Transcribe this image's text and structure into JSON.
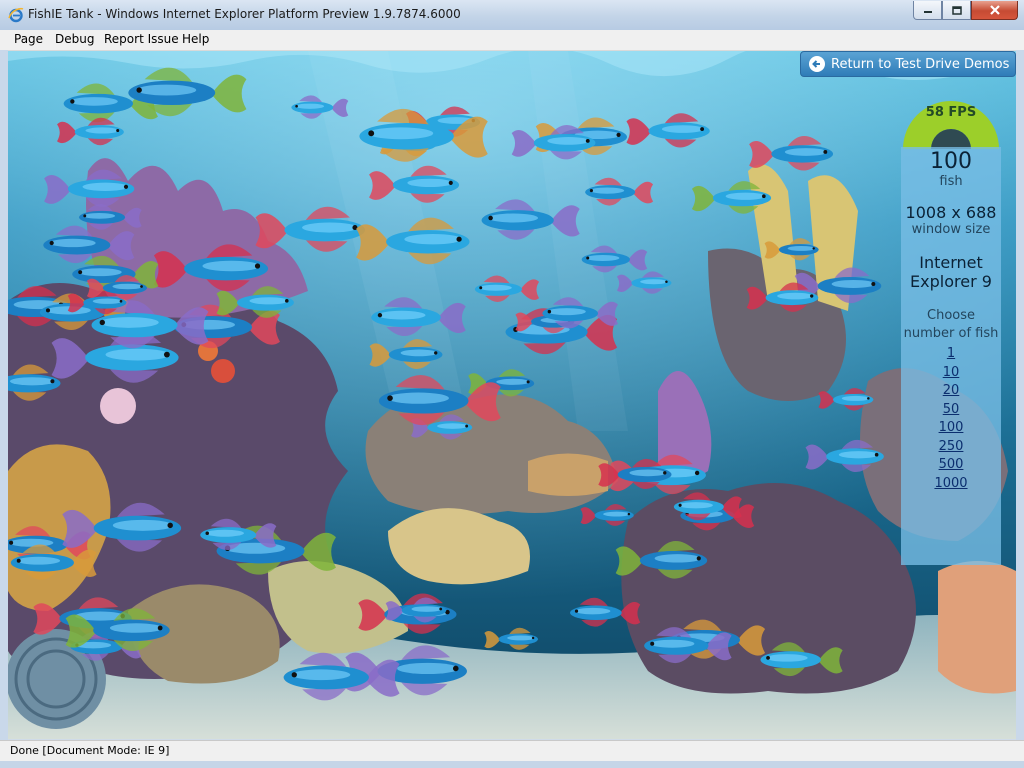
{
  "window": {
    "title": "FishIE Tank - Windows Internet Explorer Platform Preview 1.9.7874.6000",
    "controls": [
      "minimize",
      "maximize",
      "close"
    ]
  },
  "menubar": {
    "items": [
      {
        "label": "Page",
        "key": "P"
      },
      {
        "label": "Debug",
        "key": "D"
      },
      {
        "label": "Report Issue",
        "key": "R"
      },
      {
        "label": "Help",
        "key": "H"
      }
    ]
  },
  "page": {
    "return_button": "Return to Test Drive Demos",
    "fps_label": "58 FPS",
    "fish_count": "100",
    "fish_label": "fish",
    "window_size": "1008 x 688",
    "window_size_label": "window size",
    "browser_line1": "Internet",
    "browser_line2": "Explorer 9",
    "choose_label": "Choose number of fish",
    "counts": [
      "1",
      "10",
      "20",
      "50",
      "100",
      "250",
      "500",
      "1000"
    ]
  },
  "status": {
    "text": "Done [Document Mode: IE 9]"
  },
  "colors": {
    "water_top": "#3b9fc8",
    "water_bottom": "#0c3c55",
    "fps_gauge": "#9ccf2a",
    "info_panel": "#78bee6"
  }
}
